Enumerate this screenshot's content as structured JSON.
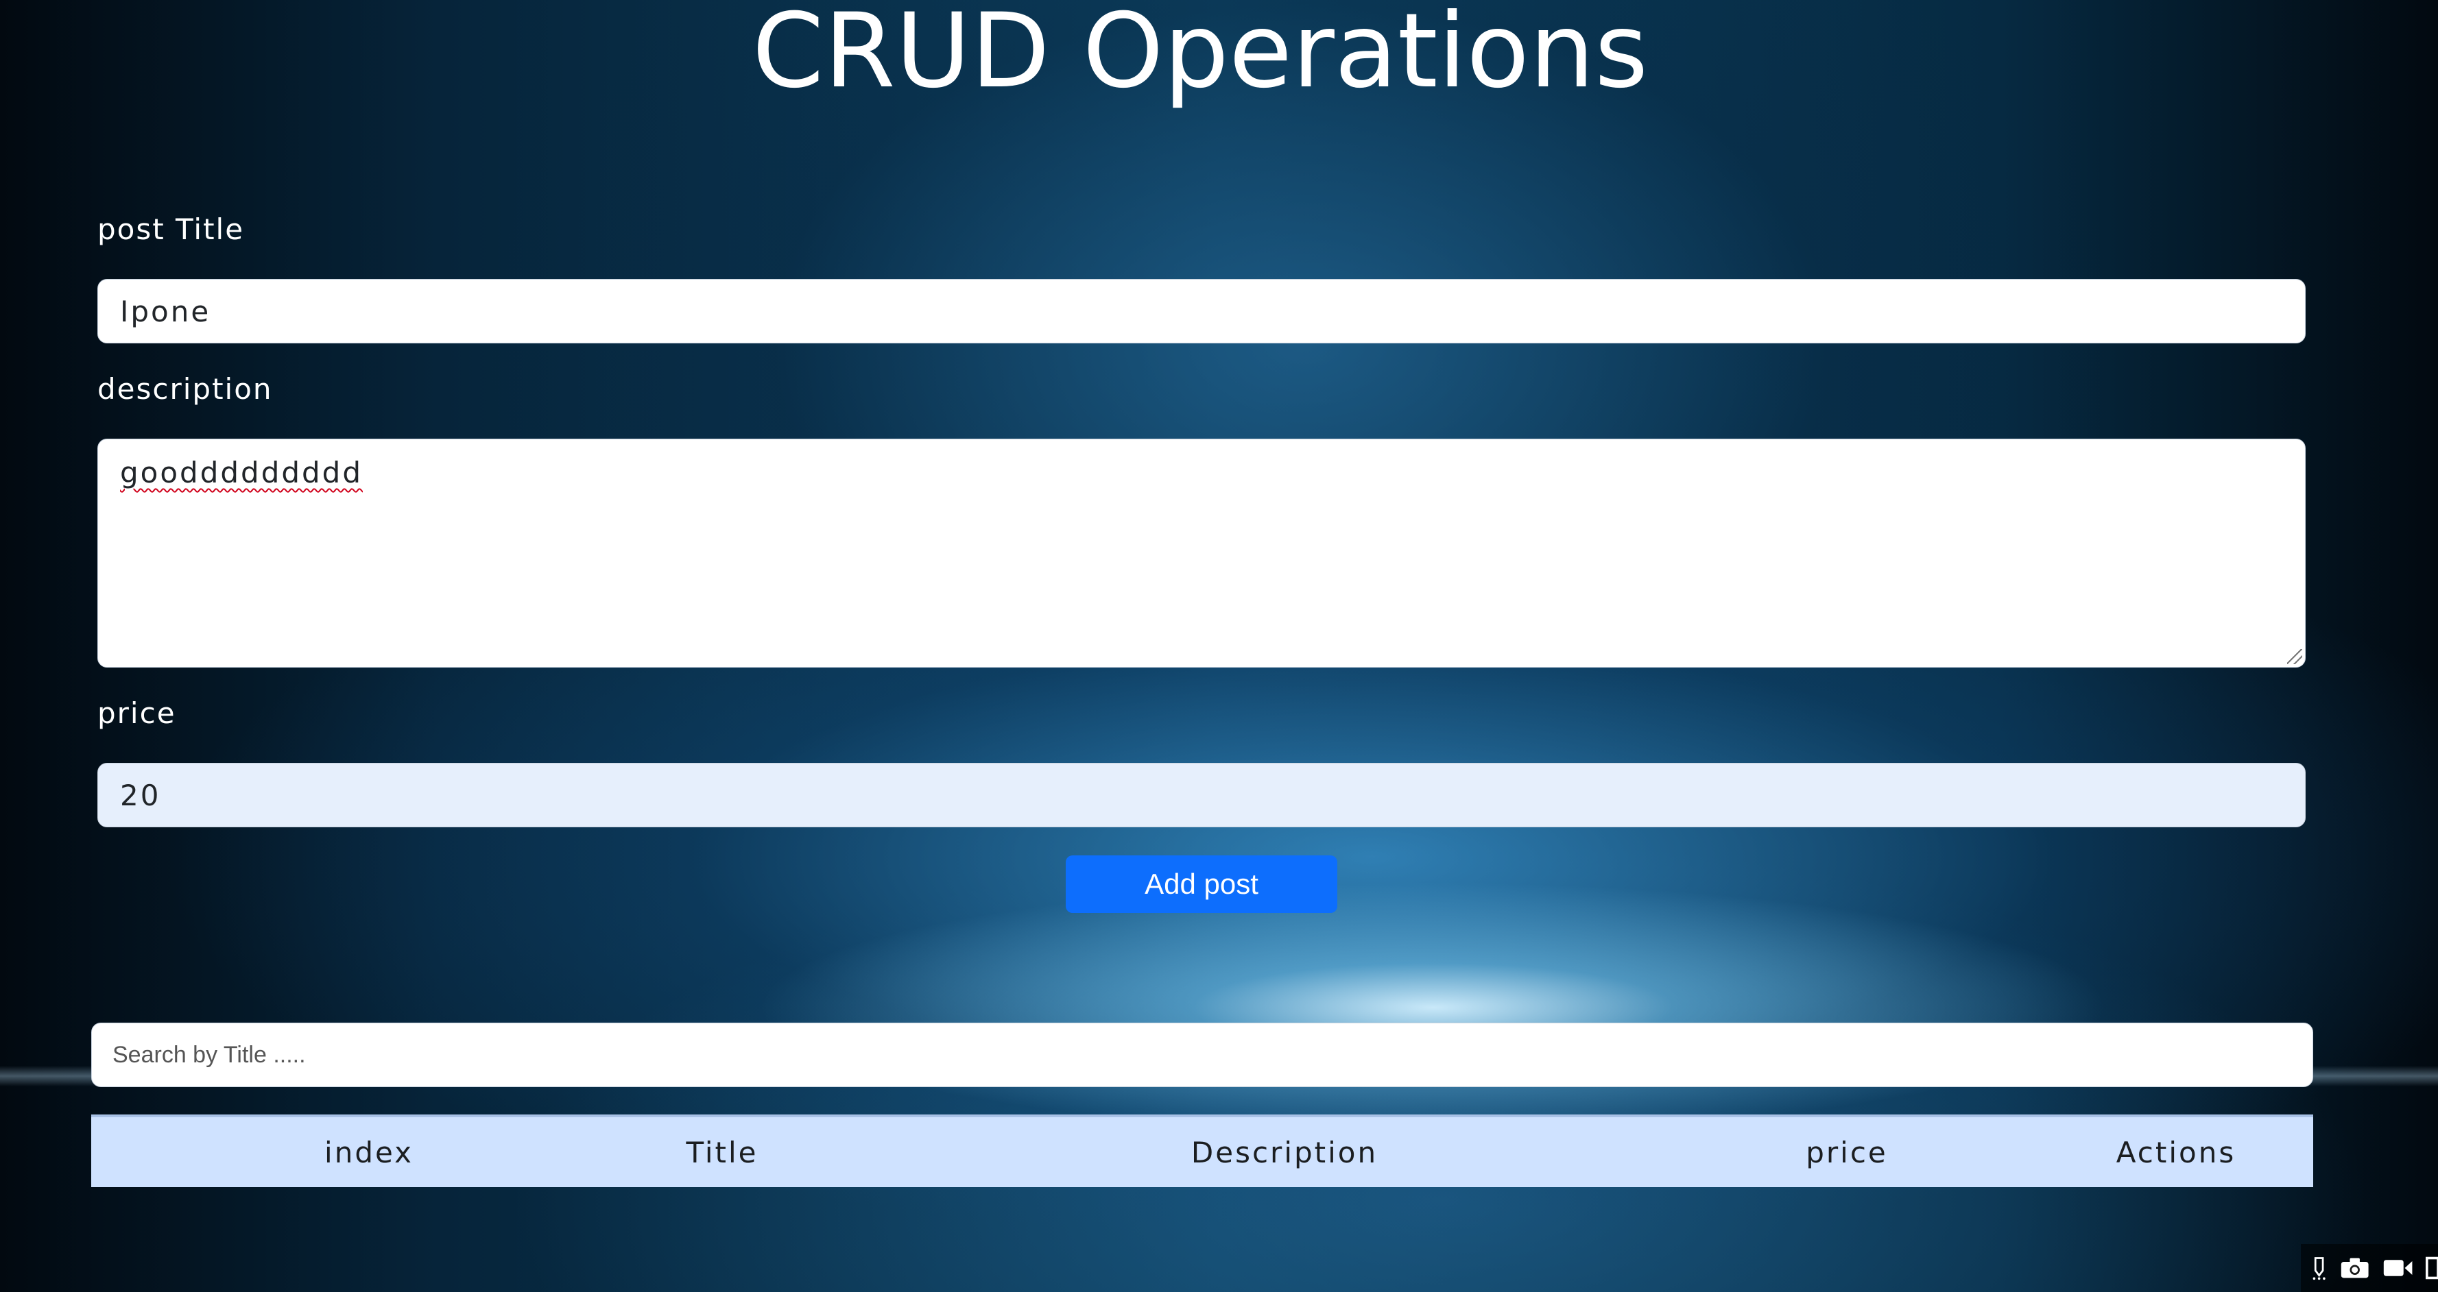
{
  "page": {
    "title": "CRUD Operations"
  },
  "form": {
    "title_label": "post Title",
    "title_value": "Ipone",
    "description_label": "description",
    "description_value": "gooddddddddd",
    "price_label": "price",
    "price_value": "20",
    "submit_label": "Add post"
  },
  "search": {
    "placeholder": "Search by Title ....."
  },
  "table": {
    "headers": [
      "index",
      "Title",
      "Description",
      "price",
      "Actions"
    ]
  },
  "tray": {
    "icons": [
      "pen-icon",
      "camera-icon",
      "video-camera-icon",
      "window-icon"
    ]
  },
  "colors": {
    "primary_button": "#0d6efd",
    "table_header_bg": "#cfe2ff",
    "price_input_bg": "#e6effc"
  }
}
